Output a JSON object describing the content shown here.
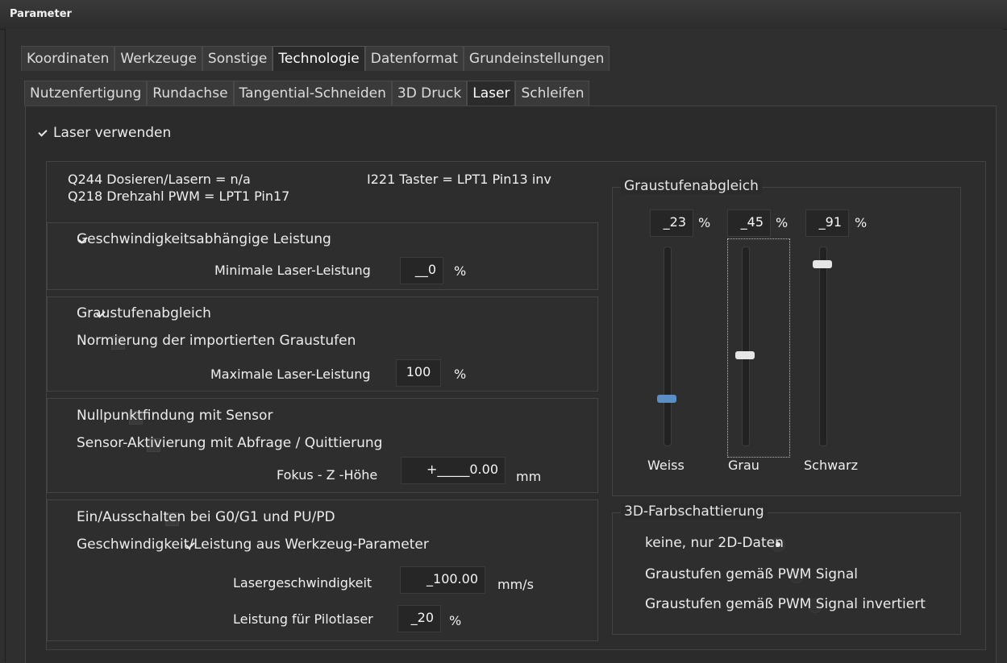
{
  "window": {
    "title": "Parameter"
  },
  "tabs_main": [
    "Koordinaten",
    "Werkzeuge",
    "Sonstige",
    "Technologie",
    "Datenformat",
    "Grundeinstellungen"
  ],
  "tabs_sub": [
    "Nutzenfertigung",
    "Rundachse",
    "Tangential-Schneiden",
    "3D Druck",
    "Laser",
    "Schleifen"
  ],
  "laser": {
    "use_laser": "Laser verwenden",
    "info": {
      "q244": "Q244 Dosieren/Lasern = n/a",
      "i221": "I221 Taster = LPT1 Pin13 inv",
      "q218": "Q218 Drehzahl PWM = LPT1 Pin17"
    },
    "speed_power": {
      "checkbox": "Geschwindigkeitsabhängige Leistung",
      "min_label": "Minimale Laser-Leistung",
      "min_value": "__0",
      "unit": "%"
    },
    "gray": {
      "checkbox": "Graustufenabgleich",
      "normalize": "Normierung der importierten Graustufen",
      "max_label": "Maximale Laser-Leistung",
      "max_value": "100",
      "unit": "%"
    },
    "sensor": {
      "zero": "Nullpunktfindung mit Sensor",
      "activation": "Sensor-Aktivierung mit Abfrage / Quittierung",
      "focus_label": "Fokus - Z -Höhe",
      "focus_value": "+_____0.00",
      "unit": "mm"
    },
    "switching": {
      "g0g1": "Ein/Ausschalten bei G0/G1 und PU/PD",
      "from_tool": "Geschwindigkeit/Leistung aus Werkzeug-Parameter",
      "speed_label": "Lasergeschwindigkeit",
      "speed_value": "_100.00",
      "speed_unit": "mm/s",
      "pilot_label": "Leistung für Pilotlaser",
      "pilot_value": "_20",
      "pilot_unit": "%"
    }
  },
  "gray_balance": {
    "title": "Graustufenabgleich",
    "unit": "%",
    "sliders": [
      {
        "label": "Weiss",
        "value": "_23",
        "level": 0.23,
        "color": "#5b8ec6"
      },
      {
        "label": "Grau",
        "value": "_45",
        "level": 0.45,
        "color": "#e6e6e6"
      },
      {
        "label": "Schwarz",
        "value": "_91",
        "level": 0.91,
        "color": "#e6e6e6"
      }
    ]
  },
  "shading": {
    "title": "3D-Farbschattierung",
    "options": [
      "keine, nur 2D-Daten",
      "Graustufen gemäß PWM Signal",
      "Graustufen gemäß PWM Signal invertiert"
    ]
  }
}
